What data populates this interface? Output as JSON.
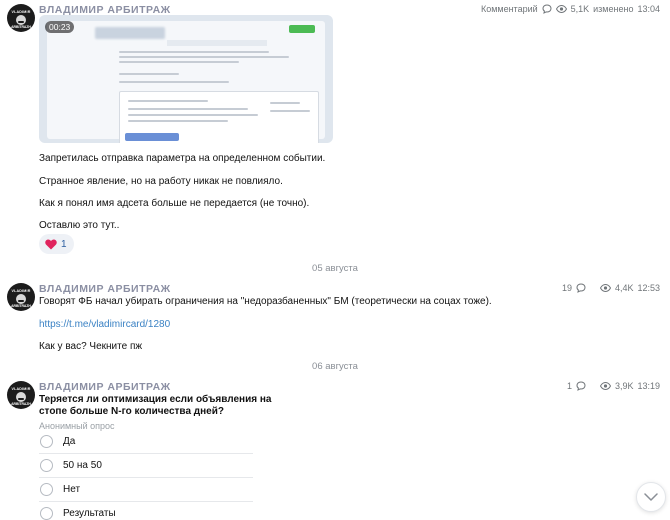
{
  "posts": [
    {
      "author": "ВЛАДИМИР АРБИТРАЖ",
      "avatar": {
        "top_text": "VLADIMIR",
        "bottom_text": "ARBITRAZH"
      },
      "comments_label": "Комментарий",
      "views": "5,1K",
      "edited_label": "изменено",
      "time": "13:04",
      "video_time": "00:23",
      "lines": [
        "Запретилась отправка параметра на определенном событии.",
        "Странное явление, но на работу никак не повлияло.",
        "Как я понял имя адсета больше не передается (не точно).",
        "Оставлю это тут.."
      ],
      "reaction": {
        "emoji_icon": "heart-icon",
        "count": "1"
      }
    },
    {
      "author": "ВЛАДИМИР АРБИТРАЖ",
      "avatar": {
        "top_text": "VLADIMIR",
        "bottom_text": "ARBITRAZH"
      },
      "comments_count": "19",
      "views": "4,4K",
      "time": "12:53",
      "lines": [
        "Говорят ФБ начал убирать ограничения на \"недоразбаненных\" БМ (теоретически на соцах тоже).",
        "https://t.me/vladimircard/1280",
        "Как у вас? Чекните пж"
      ]
    },
    {
      "author": "ВЛАДИМИР АРБИТРАЖ",
      "avatar": {
        "top_text": "VLADIMIR",
        "bottom_text": "ARBITRAZH"
      },
      "comments_count": "1",
      "views": "3,9K",
      "time": "13:19",
      "poll": {
        "question": "Теряется ли оптимизация если объявления на стопе больше N-го количества дней?",
        "type_label": "Анонимный опрос",
        "options": [
          "Да",
          "50 на 50",
          "Нет",
          "Результаты"
        ]
      }
    }
  ],
  "date_separators": [
    "05 августа",
    "06 августа"
  ],
  "colors": {
    "accent": "#3b82c4",
    "author": "#8b8fa3",
    "heart": "#e0245e"
  }
}
